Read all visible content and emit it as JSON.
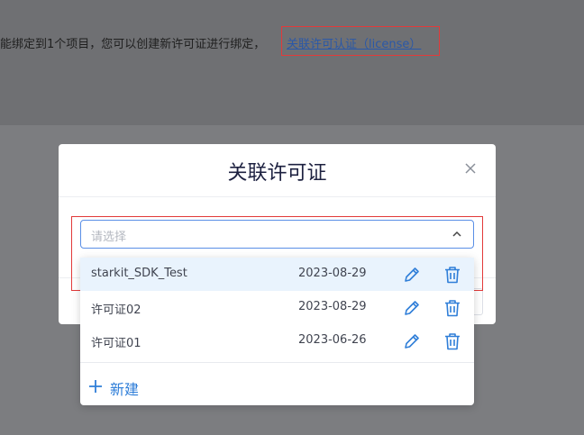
{
  "background": {
    "description_text": "能绑定到1个项目，您可以创建新许可证进行绑定，",
    "link_text": "关联许可认证（license）"
  },
  "modal": {
    "title": "关联许可证",
    "close_icon": "close-icon"
  },
  "select": {
    "placeholder": "请选择",
    "arrow_icon": "chevron-up-icon"
  },
  "options": [
    {
      "name": "starkit_SDK_Test",
      "date": "2023-08-29",
      "selected": true
    },
    {
      "name": "许可证02",
      "date": "2023-08-29",
      "selected": false
    },
    {
      "name": "许可证01",
      "date": "2023-06-26",
      "selected": false
    }
  ],
  "new_button": {
    "label": "新建",
    "icon": "plus-icon"
  },
  "colors": {
    "accent": "#2f7ed8",
    "highlight_border": "#e23a3a",
    "selected_bg": "#e9f3fd"
  }
}
